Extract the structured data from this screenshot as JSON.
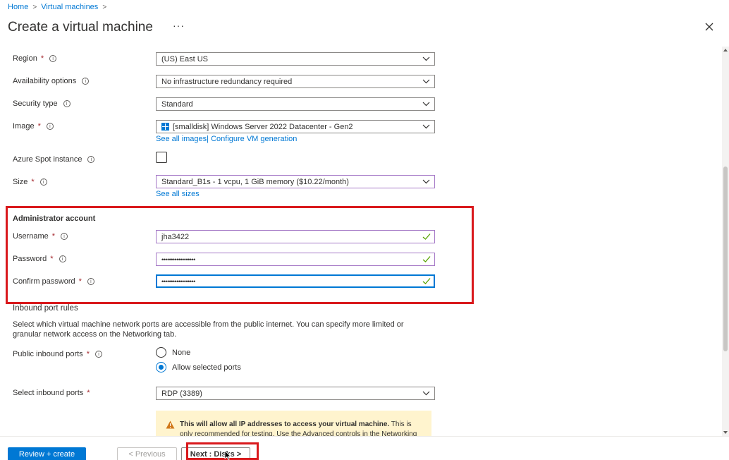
{
  "breadcrumb": {
    "home": "Home",
    "sep": ">",
    "vms": "Virtual machines"
  },
  "header": {
    "title": "Create a virtual machine",
    "more": "···"
  },
  "form": {
    "region": {
      "label": "Region",
      "value": "(US) East US"
    },
    "availability": {
      "label": "Availability options",
      "value": "No infrastructure redundancy required"
    },
    "security": {
      "label": "Security type",
      "value": "Standard"
    },
    "image": {
      "label": "Image",
      "value": "[smalldisk] Windows Server 2022 Datacenter - Gen2",
      "link_all": "See all images",
      "link_sep": "|",
      "link_config": "Configure VM generation"
    },
    "spot": {
      "label": "Azure Spot instance",
      "checked": false
    },
    "size": {
      "label": "Size",
      "value": "Standard_B1s - 1 vcpu, 1 GiB memory ($10.22/month)",
      "link": "See all sizes"
    },
    "admin": {
      "title": "Administrator account",
      "username": {
        "label": "Username",
        "value": "jha3422"
      },
      "password": {
        "label": "Password",
        "value": "••••••••••••••••••"
      },
      "confirm": {
        "label": "Confirm password",
        "value": "••••••••••••••••••"
      }
    },
    "inbound": {
      "title": "Inbound port rules",
      "description": "Select which virtual machine network ports are accessible from the public internet. You can specify more limited or granular network access on the Networking tab.",
      "public_ports": {
        "label": "Public inbound ports",
        "options": [
          "None",
          "Allow selected ports"
        ],
        "selected": "Allow selected ports"
      },
      "select_ports": {
        "label": "Select inbound ports",
        "value": "RDP (3389)"
      },
      "warning_bold": "This will allow all IP addresses to access your virtual machine.",
      "warning_rest": " This is only recommended for testing.  Use the Advanced controls in the Networking tab to"
    },
    "required_mark": "*",
    "info_glyph": "i"
  },
  "footer": {
    "review": "Review + create",
    "previous": "< Previous",
    "next": "Next : Disks >"
  },
  "colors": {
    "accent": "#0078d4",
    "highlight": "#d9191c",
    "required": "#a4262c",
    "valid": "#57a300",
    "warning_bg": "#fff4ce"
  }
}
